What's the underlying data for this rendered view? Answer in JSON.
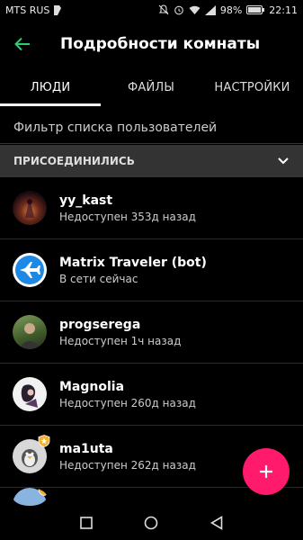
{
  "status_bar": {
    "carrier": "MTS RUS",
    "battery": "98%",
    "time": "22:11"
  },
  "header": {
    "title": "Подробности комнаты"
  },
  "tabs": [
    {
      "label": "ЛЮДИ",
      "active": true
    },
    {
      "label": "ФАЙЛЫ",
      "active": false
    },
    {
      "label": "НАСТРОЙКИ",
      "active": false
    }
  ],
  "filter": {
    "placeholder": "Фильтр списка пользователей"
  },
  "section": {
    "title": "ПРИСОЕДИНИЛИСЬ"
  },
  "members": [
    {
      "name": "yy_kast",
      "status": "Недоступен 353д назад"
    },
    {
      "name": "Matrix Traveler (bot)",
      "status": "В сети сейчас"
    },
    {
      "name": "progserega",
      "status": "Недоступен 1ч назад"
    },
    {
      "name": "Magnolia",
      "status": "Недоступен 260д назад"
    },
    {
      "name": "ma1uta",
      "status": "Недоступен 262д назад"
    }
  ],
  "colors": {
    "accent": "#ff1a6b",
    "back_arrow": "#2ecc71",
    "section_bg": "#333333"
  }
}
